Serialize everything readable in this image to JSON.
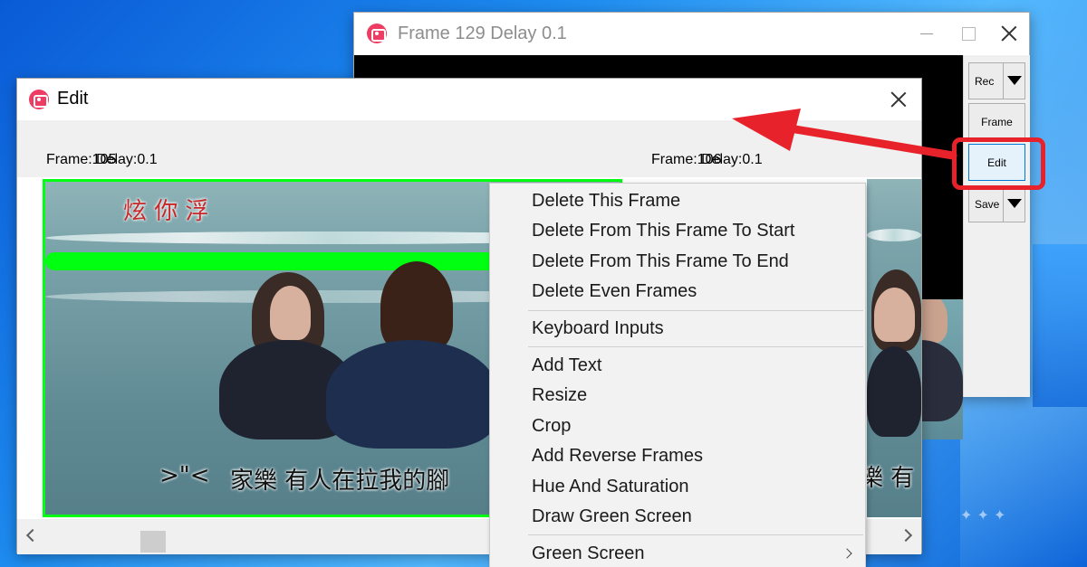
{
  "back_window": {
    "title": "Frame 129 Delay 0.1",
    "side_buttons": {
      "rec": "Rec",
      "frame": "Frame",
      "edit": "Edit",
      "save": "Save"
    }
  },
  "edit_window": {
    "title": "Edit",
    "frames": [
      {
        "frame_text": "Frame:105",
        "delay_text": "Delay:0.1",
        "selected": true,
        "subtitle_left": ">\"<",
        "subtitle_text": "家樂 有人在拉我的腳"
      },
      {
        "frame_text": "Frame:106",
        "delay_text": "Delay:0.1",
        "selected": false,
        "subtitle_text": "樂 有"
      }
    ],
    "caption_top": "炫 你 浮"
  },
  "context_menu": {
    "items": [
      {
        "label": "Delete This Frame"
      },
      {
        "label": "Delete From This Frame To Start"
      },
      {
        "label": "Delete From This Frame To End"
      },
      {
        "label": "Delete Even Frames"
      },
      {
        "label": "Keyboard Inputs"
      },
      {
        "label": "Add Text"
      },
      {
        "label": "Resize"
      },
      {
        "label": "Crop"
      },
      {
        "label": "Add Reverse Frames"
      },
      {
        "label": "Hue And Saturation"
      },
      {
        "label": "Draw Green Screen"
      },
      {
        "label": "Green Screen",
        "has_submenu": true
      }
    ]
  },
  "colors": {
    "highlight_red": "#e8222b",
    "green_screen": "#00ff10",
    "app_icon": "#ee3d62"
  },
  "icons": {
    "app": "camera-icon",
    "close": "close-icon",
    "minimize": "minimize-icon",
    "maximize": "maximize-icon",
    "dropdown": "caret-down-icon",
    "submenu": "chevron-right-icon"
  }
}
